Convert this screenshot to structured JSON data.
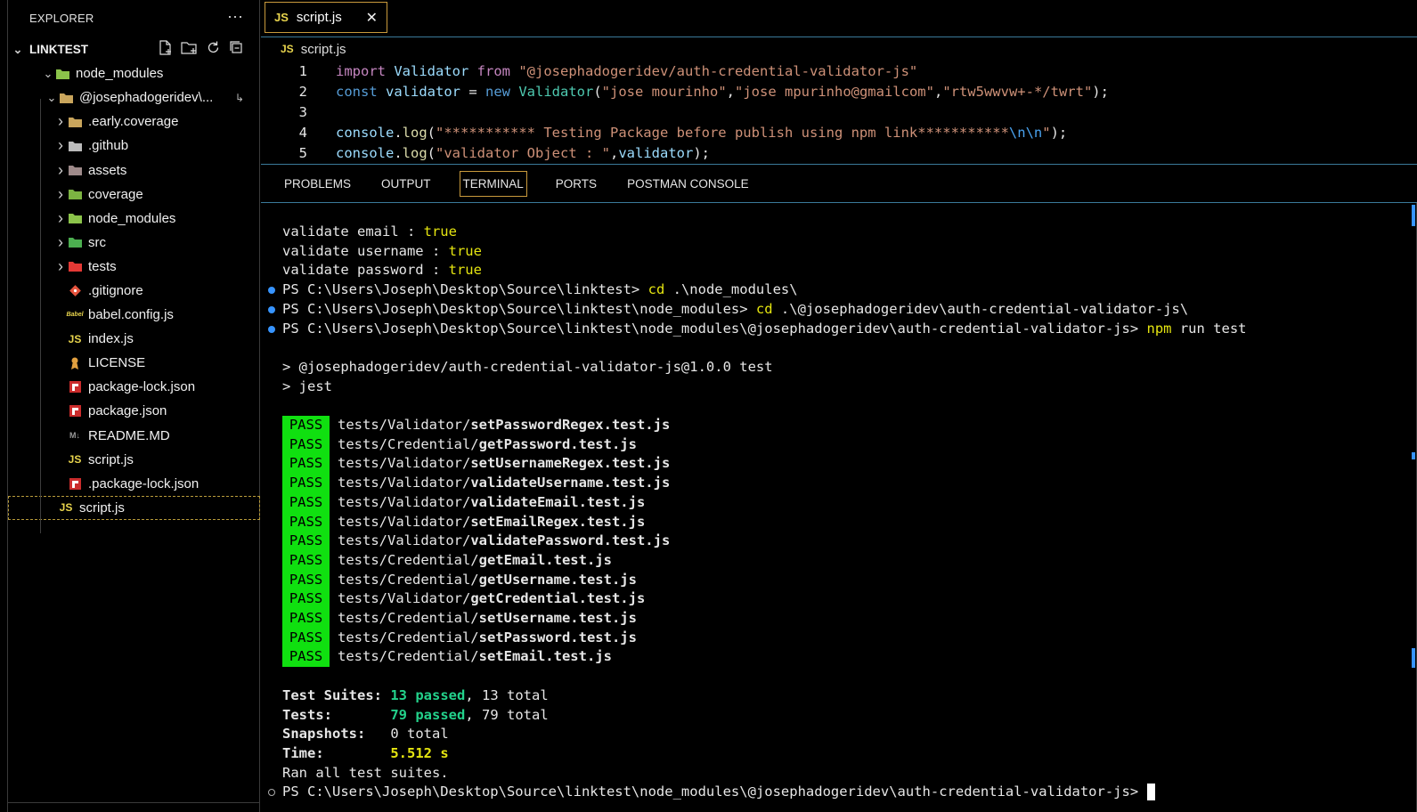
{
  "explorer": {
    "title": "EXPLORER",
    "more": "···",
    "root": "LINKTEST",
    "items": [
      {
        "label": "node_modules",
        "level": 1,
        "chevron": "open",
        "icon": "folder-node"
      },
      {
        "label": "@josephadogeridev\\...",
        "level": 2,
        "chevron": "open",
        "icon": "folder",
        "badge": "↳"
      },
      {
        "label": ".early.coverage",
        "level": 3,
        "chevron": "closed",
        "icon": "folder"
      },
      {
        "label": ".github",
        "level": 3,
        "chevron": "closed",
        "icon": "folder-github"
      },
      {
        "label": "assets",
        "level": 3,
        "chevron": "closed",
        "icon": "folder-assets"
      },
      {
        "label": "coverage",
        "level": 3,
        "chevron": "closed",
        "icon": "folder-coverage"
      },
      {
        "label": "node_modules",
        "level": 3,
        "chevron": "closed",
        "icon": "folder-node"
      },
      {
        "label": "src",
        "level": 3,
        "chevron": "closed",
        "icon": "folder-src"
      },
      {
        "label": "tests",
        "level": 3,
        "chevron": "closed",
        "icon": "folder-tests"
      },
      {
        "label": ".gitignore",
        "level": 3,
        "chevron": "none",
        "icon": "git"
      },
      {
        "label": "babel.config.js",
        "level": 3,
        "chevron": "none",
        "icon": "babel"
      },
      {
        "label": "index.js",
        "level": 3,
        "chevron": "none",
        "icon": "js"
      },
      {
        "label": "LICENSE",
        "level": 3,
        "chevron": "none",
        "icon": "license"
      },
      {
        "label": "package-lock.json",
        "level": 3,
        "chevron": "none",
        "icon": "npm"
      },
      {
        "label": "package.json",
        "level": 3,
        "chevron": "none",
        "icon": "npm"
      },
      {
        "label": "README.MD",
        "level": 3,
        "chevron": "none",
        "icon": "markdown"
      },
      {
        "label": "script.js",
        "level": 3,
        "chevron": "none",
        "icon": "js"
      },
      {
        "label": ".package-lock.json",
        "level": 2,
        "chevron": "none",
        "icon": "npm"
      },
      {
        "label": "script.js",
        "level": 1,
        "chevron": "none",
        "icon": "js",
        "selected": true
      }
    ],
    "icon_text": {
      "js": "JS",
      "markdown": "M↓",
      "babel": "Babel"
    }
  },
  "tab": {
    "icon": "JS",
    "label": "script.js",
    "close": "✕"
  },
  "breadcrumb": {
    "icon": "JS",
    "label": "script.js"
  },
  "code": [
    {
      "n": "1",
      "parts": [
        [
          "kw",
          "import "
        ],
        [
          "id",
          "Validator "
        ],
        [
          "kw",
          "from "
        ],
        [
          "str",
          "\"@josephadogeridev/auth-credential-validator-js\""
        ]
      ]
    },
    {
      "n": "2",
      "parts": [
        [
          "kw2",
          "const "
        ],
        [
          "id",
          "validator "
        ],
        [
          "pl",
          "= "
        ],
        [
          "kw2",
          "new "
        ],
        [
          "cls",
          "Validator"
        ],
        [
          "pl",
          "("
        ],
        [
          "str",
          "\"jose mourinho\""
        ],
        [
          "pl",
          ","
        ],
        [
          "str",
          "\"jose mpurinho@gmailcom\""
        ],
        [
          "pl",
          ","
        ],
        [
          "str",
          "\"rtw5wwvw+-*/twrt\""
        ],
        [
          "pl",
          ");"
        ]
      ]
    },
    {
      "n": "3",
      "parts": []
    },
    {
      "n": "4",
      "parts": [
        [
          "id",
          "console"
        ],
        [
          "pl",
          "."
        ],
        [
          "fn",
          "log"
        ],
        [
          "pl",
          "("
        ],
        [
          "str",
          "\"*********** Testing Package before publish using npm link***********"
        ],
        [
          "esc",
          "\\n\\n"
        ],
        [
          "str",
          "\""
        ],
        [
          "pl",
          ");"
        ]
      ]
    },
    {
      "n": "5",
      "parts": [
        [
          "id",
          "console"
        ],
        [
          "pl",
          "."
        ],
        [
          "fn",
          "log"
        ],
        [
          "pl",
          "("
        ],
        [
          "str",
          "\"validator Object : \""
        ],
        [
          "pl",
          ","
        ],
        [
          "id",
          "validator"
        ],
        [
          "pl",
          ");"
        ]
      ]
    }
  ],
  "panel_tabs": [
    "PROBLEMS",
    "OUTPUT",
    "TERMINAL",
    "PORTS",
    "POSTMAN CONSOLE"
  ],
  "panel_active": "TERMINAL",
  "terminal": {
    "validate_lines": [
      {
        "label": "validate email : ",
        "value": "true"
      },
      {
        "label": "validate username : ",
        "value": "true"
      },
      {
        "label": "validate password : ",
        "value": "true"
      }
    ],
    "commands": [
      {
        "prompt": "PS C:\\Users\\Joseph\\Desktop\\Source\\linktest> ",
        "cmd": "cd",
        "args": " .\\node_modules\\"
      },
      {
        "prompt": "PS C:\\Users\\Joseph\\Desktop\\Source\\linktest\\node_modules> ",
        "cmd": "cd",
        "args": " .\\@josephadogeridev\\auth-credential-validator-js\\"
      },
      {
        "prompt": "PS C:\\Users\\Joseph\\Desktop\\Source\\linktest\\node_modules\\@josephadogeridev\\auth-credential-validator-js> ",
        "cmd": "npm",
        "args": " run test"
      }
    ],
    "script_lines": [
      "> @josephadogeridev/auth-credential-validator-js@1.0.0 test",
      "> jest"
    ],
    "pass_label": "PASS",
    "results": [
      {
        "dir": "tests/Validator/",
        "file": "setPasswordRegex.test.js"
      },
      {
        "dir": "tests/Credential/",
        "file": "getPassword.test.js"
      },
      {
        "dir": "tests/Validator/",
        "file": "setUsernameRegex.test.js"
      },
      {
        "dir": "tests/Validator/",
        "file": "validateUsername.test.js"
      },
      {
        "dir": "tests/Validator/",
        "file": "validateEmail.test.js"
      },
      {
        "dir": "tests/Validator/",
        "file": "setEmailRegex.test.js"
      },
      {
        "dir": "tests/Validator/",
        "file": "validatePassword.test.js"
      },
      {
        "dir": "tests/Credential/",
        "file": "getEmail.test.js"
      },
      {
        "dir": "tests/Credential/",
        "file": "getUsername.test.js"
      },
      {
        "dir": "tests/Validator/",
        "file": "getCredential.test.js"
      },
      {
        "dir": "tests/Credential/",
        "file": "setUsername.test.js"
      },
      {
        "dir": "tests/Credential/",
        "file": "setPassword.test.js"
      },
      {
        "dir": "tests/Credential/",
        "file": "setEmail.test.js"
      }
    ],
    "summary": {
      "suites_label": "Test Suites: ",
      "suites_passed": "13 passed",
      "suites_total": ", 13 total",
      "tests_label": "Tests:       ",
      "tests_passed": "79 passed",
      "tests_total": ", 79 total",
      "snapshots_label": "Snapshots:   ",
      "snapshots_value": "0 total",
      "time_label": "Time:        ",
      "time_value": "5.512 s",
      "ran": "Ran all test suites."
    },
    "final_prompt": "PS C:\\Users\\Joseph\\Desktop\\Source\\linktest\\node_modules\\@josephadogeridev\\auth-credential-validator-js> "
  }
}
